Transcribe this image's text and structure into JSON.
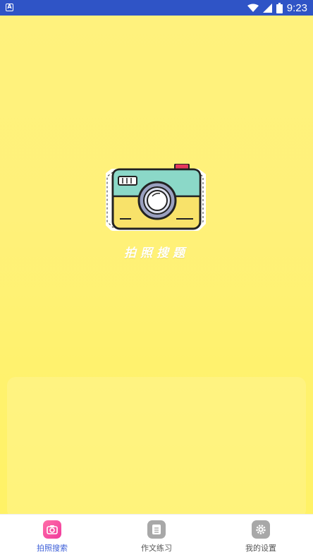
{
  "status_bar": {
    "left_icon": "accessibility-a-icon",
    "left_glyph": "A",
    "icons": [
      "wifi-icon",
      "cellular-signal-icon",
      "battery-icon"
    ],
    "time": "9:23"
  },
  "main": {
    "logo_icon": "camera-illustration",
    "title": "拍照搜题"
  },
  "tab_bar": {
    "tabs": [
      {
        "label": "拍照搜索",
        "icon": "camera-icon",
        "active": true
      },
      {
        "label": "作文练习",
        "icon": "document-icon",
        "active": false
      },
      {
        "label": "我的设置",
        "icon": "gear-icon",
        "active": false
      }
    ]
  },
  "colors": {
    "status_bar": "#2f54c6",
    "background_yellow": "#fff27d",
    "active_tab_text": "#3d5fd8",
    "active_tab_icon": "#f0399c",
    "inactive_tab_icon": "#a8a8a8"
  }
}
